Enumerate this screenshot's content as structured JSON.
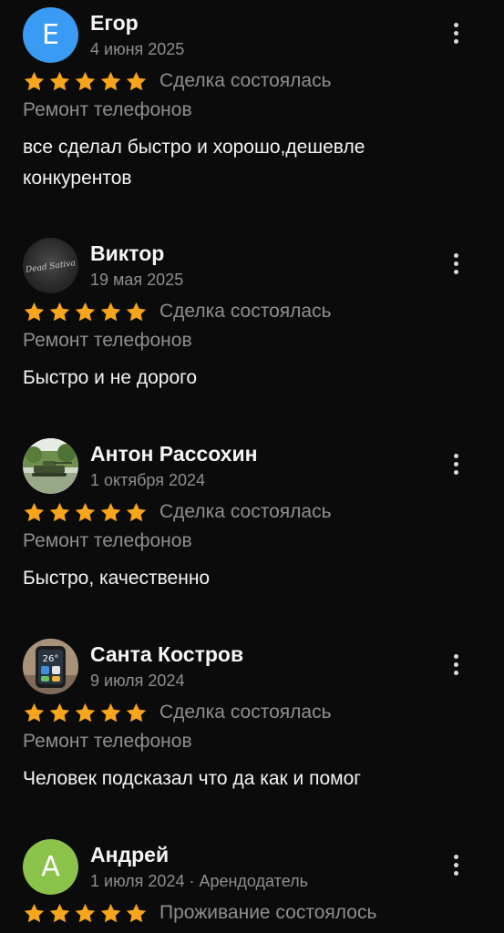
{
  "colors": {
    "background": "#0b0b0b",
    "star": "#f7a51c",
    "muted": "#8e8e8e",
    "avatar_e": "#3a9bf4",
    "avatar_a": "#8bc34a"
  },
  "icons": {
    "star": "star-icon",
    "more": "more-vertical-icon"
  },
  "reviews": [
    {
      "avatar_letter": "Е",
      "author": "Егор",
      "date": "4 июня 2025",
      "rating": 5,
      "deal": "Сделка состоялась",
      "category": "Ремонт телефонов",
      "text": "все сделал быстро и хорошо,дешевле конкурентов"
    },
    {
      "avatar_caption": "Dead Sativa",
      "author": "Виктор",
      "date": "19 мая 2025",
      "rating": 5,
      "deal": "Сделка состоялась",
      "category": "Ремонт телефонов",
      "text": "Быстро и не дорого"
    },
    {
      "author": "Антон Рассохин",
      "date": "1 октября 2024",
      "rating": 5,
      "deal": "Сделка состоялась",
      "category": "Ремонт телефонов",
      "text": "Быстро, качественно"
    },
    {
      "avatar_caption": "26°",
      "author": "Санта Костров",
      "date": "9 июля 2024",
      "rating": 5,
      "deal": "Сделка состоялась",
      "category": "Ремонт телефонов",
      "text": "Человек подсказал что да как и помог"
    },
    {
      "avatar_letter": "А",
      "author": "Андрей",
      "date": "1 июля 2024 · Арендодатель",
      "rating": 5,
      "deal": "Проживание состоялось"
    }
  ]
}
